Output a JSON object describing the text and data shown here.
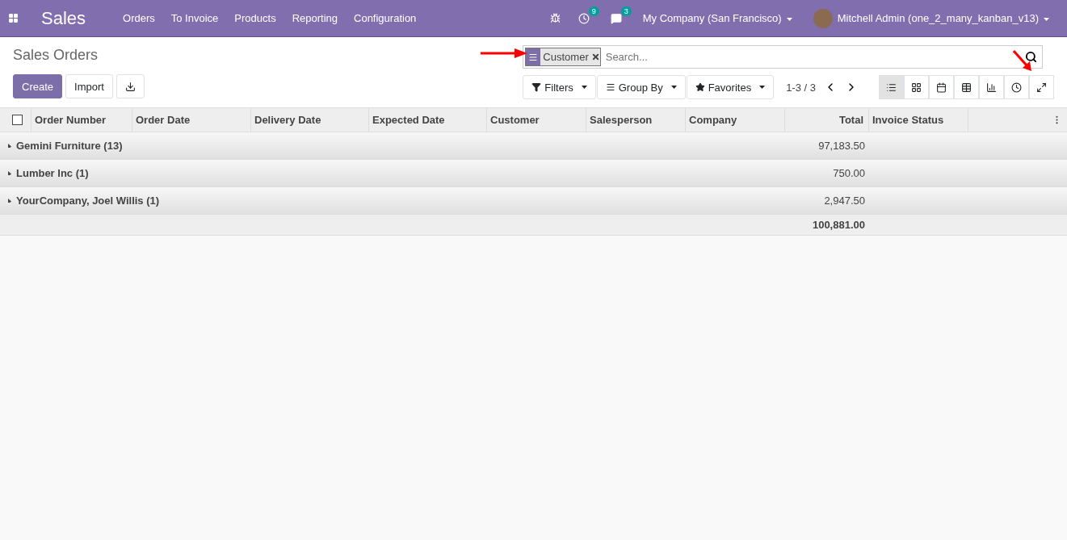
{
  "navbar": {
    "app_name": "Sales",
    "menu": [
      "Orders",
      "To Invoice",
      "Products",
      "Reporting",
      "Configuration"
    ],
    "activity_count": "9",
    "message_count": "3",
    "company": "My Company (San Francisco)",
    "user": "Mitchell Admin (one_2_many_kanban_v13)"
  },
  "control_panel": {
    "title": "Sales Orders",
    "buttons": [
      "Create",
      "Import"
    ],
    "search": {
      "facet": "Customer",
      "placeholder": "Search..."
    },
    "dropdowns": [
      "Filters",
      "Group By",
      "Favorites"
    ],
    "pager": "1-3 / 3",
    "views": [
      {
        "kind": "list",
        "selected": true
      },
      {
        "kind": "kanban",
        "selected": false
      },
      {
        "kind": "calendar",
        "selected": false
      },
      {
        "kind": "pivot",
        "selected": false
      },
      {
        "kind": "graph",
        "selected": false
      },
      {
        "kind": "activity",
        "selected": false
      },
      {
        "kind": "expand",
        "selected": false
      }
    ]
  },
  "table": {
    "select_all_checked": false,
    "columns": [
      "Order Number",
      "Order Date",
      "Delivery Date",
      "Expected Date",
      "Customer",
      "Salesperson",
      "Company",
      "Total",
      "Invoice Status"
    ],
    "groups": [
      {
        "name": "Gemini Furniture (13)",
        "total": "97,183.50",
        "expanded": false
      },
      {
        "name": "Lumber Inc (1)",
        "total": "750.00",
        "expanded": false
      },
      {
        "name": "YourCompany, Joel Willis (1)",
        "total": "2,947.50",
        "expanded": false
      }
    ],
    "grand_total": "100,881.00"
  }
}
